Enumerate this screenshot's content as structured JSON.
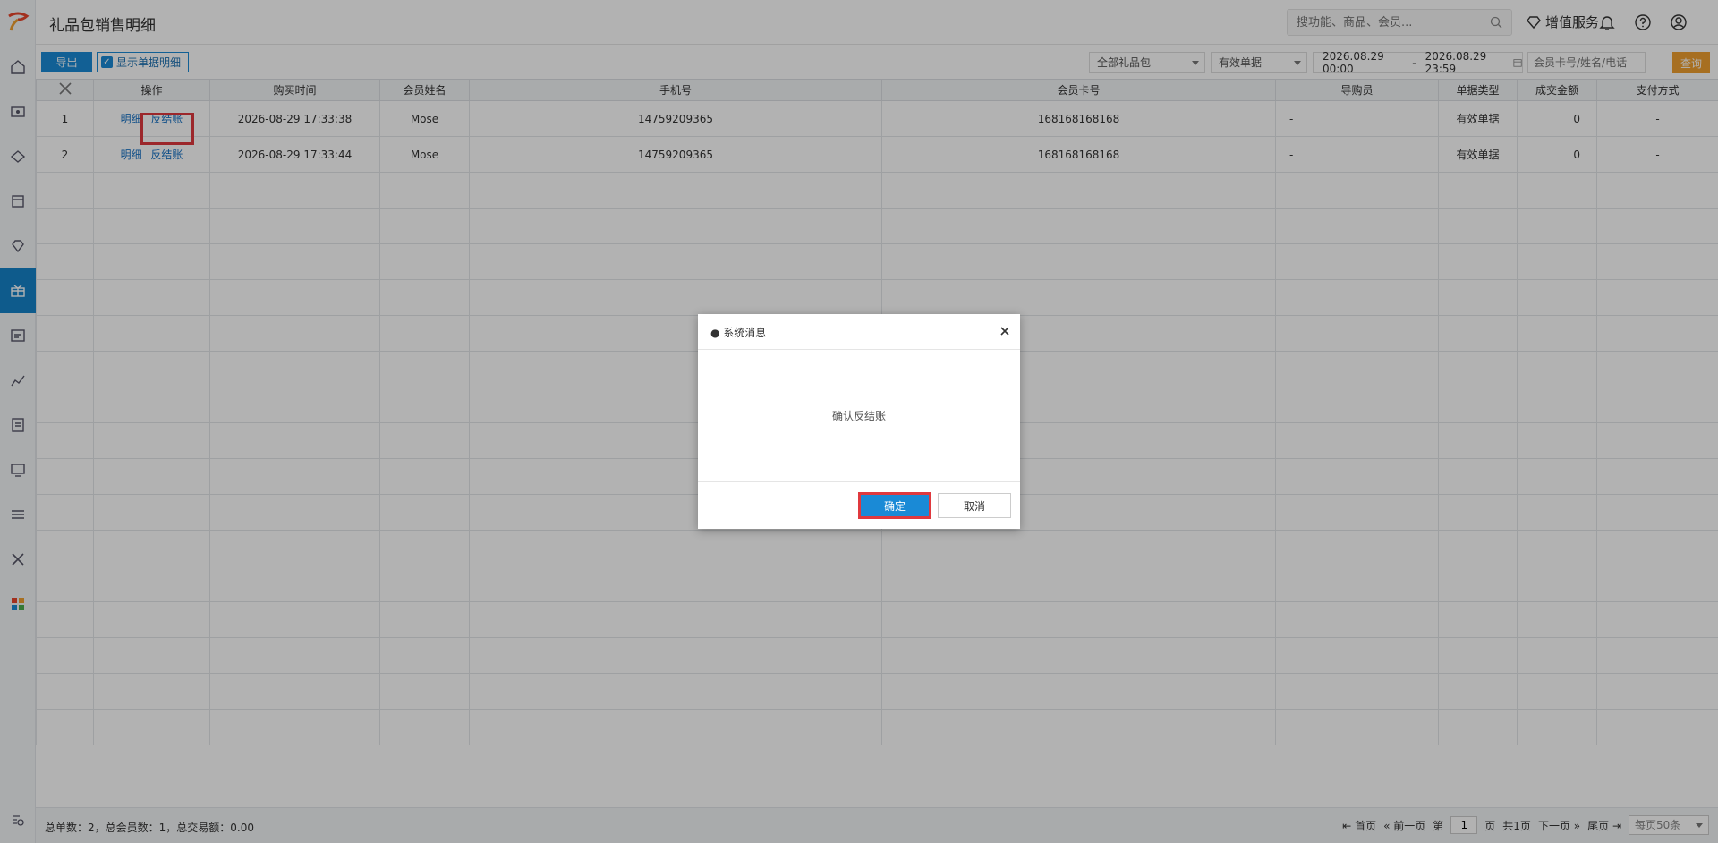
{
  "header": {
    "title": "礼品包销售明细",
    "search_placeholder": "搜功能、商品、会员...",
    "value_added_service": "增值服务"
  },
  "toolbar": {
    "export_label": "导出",
    "show_detail_label": "显示单据明细",
    "gift_select": "全部礼品包",
    "bill_select": "有效单据",
    "date_start": "2026.08.29 00:00",
    "date_sep": "-",
    "date_end": "2026.08.29 23:59",
    "member_placeholder": "会员卡号/姓名/电话",
    "query_label": "查询"
  },
  "table": {
    "columns": [
      "操作",
      "购买时间",
      "会员姓名",
      "手机号",
      "会员卡号",
      "导购员",
      "单据类型",
      "成交金额",
      "支付方式"
    ],
    "rows": [
      {
        "idx": "1",
        "detail": "明细",
        "reverse": "反结账",
        "time": "2026-08-29 17:33:38",
        "name": "Mose",
        "phone": "14759209365",
        "card": "168168168168",
        "guide": "-",
        "type": "有效单据",
        "amount": "0",
        "pay": "-"
      },
      {
        "idx": "2",
        "detail": "明细",
        "reverse": "反结账",
        "time": "2026-08-29 17:33:44",
        "name": "Mose",
        "phone": "14759209365",
        "card": "168168168168",
        "guide": "-",
        "type": "有效单据",
        "amount": "0",
        "pay": "-"
      }
    ]
  },
  "footer": {
    "summary": "总单数：2，总会员数：1，总交易额：0.00",
    "first": "首页",
    "prev": "前一页",
    "page_prefix": "第",
    "page_value": "1",
    "page_suffix": "页",
    "total_pages": "共1页",
    "next": "下一页",
    "last": "尾页",
    "per_page": "每页50条"
  },
  "dialog": {
    "title": "● 系统消息",
    "message": "确认反结账",
    "ok": "确定",
    "cancel": "取消"
  },
  "colors": {
    "primary": "#1a8ad6",
    "accent": "#f0a030",
    "highlight": "#e0393e"
  }
}
